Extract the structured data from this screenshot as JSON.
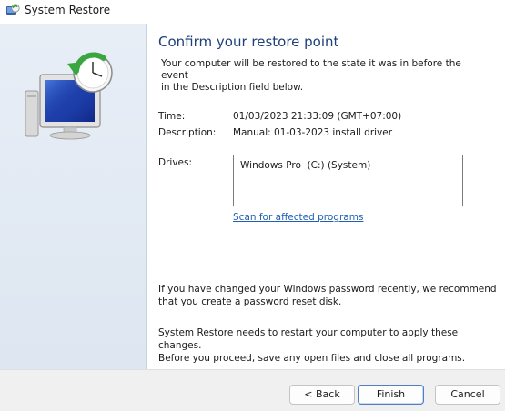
{
  "window": {
    "title": "System Restore",
    "title_icon": "system-restore-icon"
  },
  "banner": {
    "art_icon": "system-restore-monitor-clock-illustration"
  },
  "main": {
    "heading": "Confirm your restore point",
    "intro_line1": "Your computer will be restored to the state it was in before the event",
    "intro_line2": "in the Description field below.",
    "time_label": "Time:",
    "time_value": "01/03/2023 21:33:09 (GMT+07:00)",
    "description_label": "Description:",
    "description_value": "Manual: 01-03-2023 install driver",
    "drives_label": "Drives:",
    "drives": [
      "Windows Pro  (C:) (System)"
    ],
    "scan_link": "Scan for affected programs",
    "password_line1": "If you have changed your Windows password recently, we recommend",
    "password_line2": "that you create a password reset disk.",
    "restart_line1": "System Restore needs to restart your computer to apply these changes.",
    "restart_line2": "Before you proceed, save any open files and close all programs."
  },
  "footer": {
    "back_label": "< Back",
    "finish_label": "Finish",
    "cancel_label": "Cancel"
  },
  "colors": {
    "heading": "#1e3f7a",
    "link": "#1f5fb4",
    "banner": "#e3eaf4",
    "footer": "#f0f0f0"
  }
}
